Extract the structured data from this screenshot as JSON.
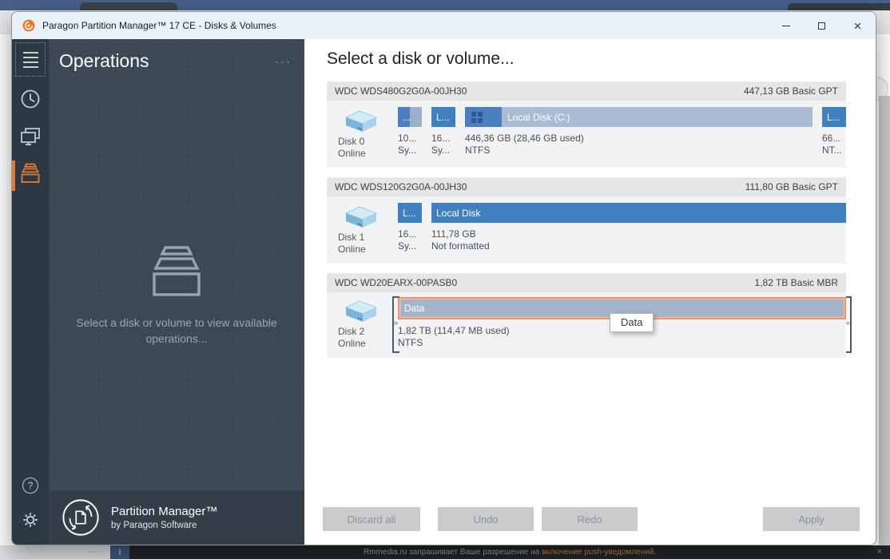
{
  "browser": {
    "tab_dots": "···",
    "notification": {
      "info_glyph": "i",
      "prefix": "Rmmedia.ru запрашивает Ваше разрешение на",
      "highlight": "включение push-уведомлений.",
      "close": "×"
    }
  },
  "window": {
    "title": "Paragon Partition Manager™ 17 CE - Disks & Volumes",
    "controls": {
      "minimize": "",
      "maximize": "",
      "close": "×"
    }
  },
  "sidebar": {
    "items": [
      {
        "icon": "menu"
      },
      {
        "icon": "history"
      },
      {
        "icon": "screens"
      },
      {
        "icon": "partitions",
        "active": true
      },
      {
        "icon": "help",
        "glyph": "?"
      },
      {
        "icon": "settings"
      }
    ]
  },
  "ops_panel": {
    "title": "Operations",
    "menu_dots": "···",
    "empty_message": "Select a disk or volume to view available operations...",
    "brand_name": "Partition Manager™",
    "brand_by": "by Paragon Software"
  },
  "main": {
    "heading": "Select a disk or volume...",
    "disks": [
      {
        "model": "WDC WDS480G2G0A-00JH30",
        "summary": "447,13 GB Basic GPT",
        "label": "Disk 0",
        "status": "Online",
        "partitions": [
          {
            "bar_label": "...",
            "size": "10...",
            "fs": "Sy..."
          },
          {
            "bar_label": "L...",
            "size": "16...",
            "fs": "Sy..."
          },
          {
            "bar_label": "Local Disk (C:)",
            "size": "446,36 GB (28,46 GB used)",
            "fs": "NTFS"
          },
          {
            "bar_label": "L...",
            "size": "66...",
            "fs": "NT..."
          }
        ]
      },
      {
        "model": "WDC WDS120G2G0A-00JH30",
        "summary": "111,80 GB Basic GPT",
        "label": "Disk 1",
        "status": "Online",
        "partitions": [
          {
            "bar_label": "L...",
            "size": "16...",
            "fs": "Sy..."
          },
          {
            "bar_label": "Local Disk",
            "size": "111,78 GB",
            "fs": "Not formatted"
          }
        ]
      },
      {
        "model": "WDC WD20EARX-00PASB0",
        "summary": "1,82 TB Basic MBR",
        "label": "Disk 2",
        "status": "Online",
        "partitions": [
          {
            "bar_label": "Data",
            "size": "1,82 TB (114,47 MB used)",
            "fs": "NTFS",
            "selected": true
          }
        ]
      }
    ],
    "tooltip": "Data",
    "actions": {
      "discard_all": "Discard all",
      "undo": "Undo",
      "redo": "Redo",
      "apply": "Apply"
    }
  },
  "colors": {
    "accent_orange": "#e8782f",
    "selection_border": "#ee9366",
    "partition_blue": "#4080c1",
    "partition_free": "#a9bcd3",
    "titlebar": "#e9f1f9",
    "sidebar": "#2c3842",
    "panel": "#3c4955"
  }
}
